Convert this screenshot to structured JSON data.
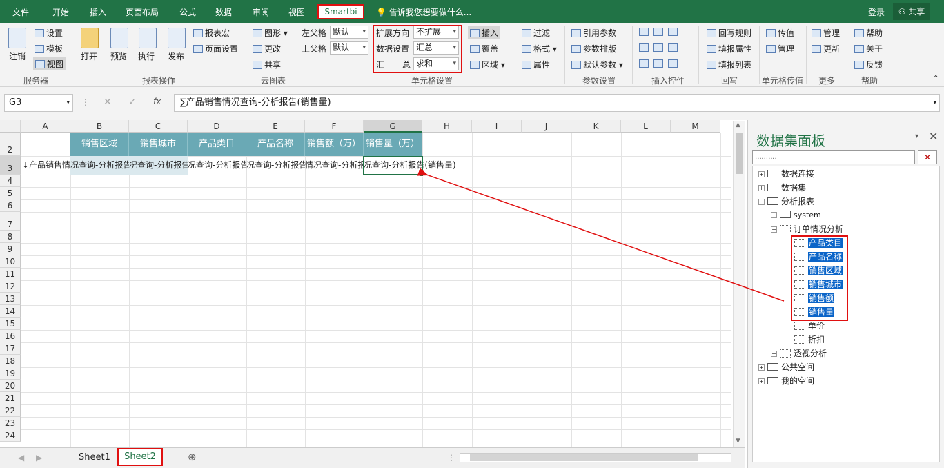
{
  "tabs": [
    "文件",
    "开始",
    "插入",
    "页面布局",
    "公式",
    "数据",
    "审阅",
    "视图"
  ],
  "active_tab": "Smartbi",
  "tellme": "告诉我您想要做什么...",
  "login": "登录",
  "share": "共享",
  "ribbon": {
    "server": {
      "logout": "注销",
      "settings": "设置",
      "template": "模板",
      "view": "视图",
      "group": "服务器"
    },
    "report": {
      "open": "打开",
      "preview": "预览",
      "exec": "执行",
      "publish": "发布",
      "macro": "报表宏",
      "page_setup": "页面设置",
      "group": "报表操作"
    },
    "cloud": {
      "chart": "图形",
      "change": "更改",
      "share": "共享",
      "group": "云图表"
    },
    "parent": {
      "left_label": "左父格",
      "left_value": "默认",
      "top_label": "上父格",
      "top_value": "默认"
    },
    "cell": {
      "expand_label": "扩展方向",
      "expand_value": "不扩展",
      "data_label": "数据设置",
      "data_value": "汇总",
      "sum_label1": "汇",
      "sum_label2": "总",
      "sum_value": "求和",
      "group": "单元格设置"
    },
    "edit": {
      "insert": "插入",
      "cover": "覆盖",
      "area": "区域",
      "filter": "过滤",
      "format": "格式",
      "attr": "属性"
    },
    "param": {
      "ref": "引用参数",
      "layout": "参数排版",
      "default": "默认参数",
      "group": "参数设置"
    },
    "ctrl": {
      "group": "插入控件"
    },
    "writeback": {
      "rule": "回写规则",
      "fill_attr": "填报属性",
      "fill_list": "填报列表",
      "group": "回写"
    },
    "transfer": {
      "pass": "传值",
      "manage": "管理",
      "group": "单元格传值"
    },
    "more": {
      "manage": "管理",
      "update": "更新",
      "group": "更多"
    },
    "help": {
      "help": "帮助",
      "about": "关于",
      "feedback": "反馈",
      "group": "帮助"
    }
  },
  "formula": {
    "cell_ref": "G3",
    "content": "∑产品销售情况查询-分析报告(销售量)"
  },
  "columns": [
    "A",
    "B",
    "C",
    "D",
    "E",
    "F",
    "G",
    "H",
    "I",
    "J",
    "K",
    "L",
    "M"
  ],
  "rows": [
    "2",
    "3",
    "4",
    "5",
    "6",
    "7",
    "8",
    "9",
    "10",
    "11",
    "12",
    "13",
    "14",
    "15",
    "16",
    "17",
    "18",
    "19",
    "20",
    "21",
    "22",
    "23",
    "24"
  ],
  "headers": [
    "销售区域",
    "销售城市",
    "产品类目",
    "产品名称",
    "销售额（万）",
    "销售量（万）"
  ],
  "row3": [
    "↓产品销售情",
    "况查询-分析报告",
    "况查询-分析报告",
    "况查询-分析报告",
    "况查询-分析报告",
    "情况查询-分析报",
    "况查询-分析报告(销售量)"
  ],
  "sheets": [
    "Sheet1",
    "Sheet2"
  ],
  "panel": {
    "title": "数据集面板",
    "search": "..........",
    "clear": "✕",
    "tree": {
      "conn": "数据连接",
      "dataset": "数据集",
      "analysis": "分析报表",
      "system": "system",
      "order": "订单情况分析",
      "fields": [
        "产品类目",
        "产品名称",
        "销售区域",
        "销售城市",
        "销售额",
        "销售量"
      ],
      "others": [
        "单价",
        "折扣"
      ],
      "pivot": "透视分析",
      "public": "公共空间",
      "mine": "我的空间"
    }
  }
}
